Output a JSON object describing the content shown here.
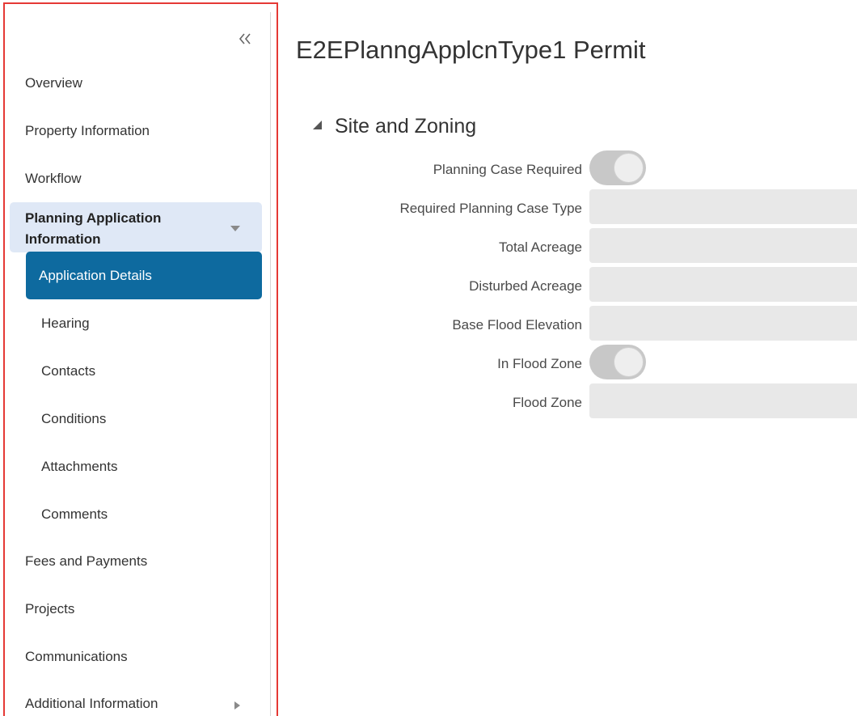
{
  "nav": {
    "overview": "Overview",
    "property_information": "Property Information",
    "workflow": "Workflow",
    "planning_application_information": "Planning Application Information",
    "application_details": "Application Details",
    "hearing": "Hearing",
    "contacts": "Contacts",
    "conditions": "Conditions",
    "attachments": "Attachments",
    "comments": "Comments",
    "fees_and_payments": "Fees and Payments",
    "projects": "Projects",
    "communications": "Communications",
    "additional_information": "Additional Information"
  },
  "icons": {
    "collapse": "double-chevron-left-icon",
    "group_expand": "caret-down-icon",
    "section_toggle": "triangle-expanded-icon",
    "submenu": "caret-right-icon"
  },
  "colors": {
    "selected_bg": "#0e6a9f",
    "group_bg": "#dfe8f6",
    "highlight_border": "#e53935",
    "field_bg": "#e8e8e8",
    "toggle_bg": "#c8c8c8"
  },
  "page": {
    "title": "E2EPlanngApplcnType1 Permit"
  },
  "section": {
    "title": "Site and Zoning",
    "fields": {
      "planning_case_required": {
        "label": "Planning Case Required",
        "value": "off"
      },
      "required_planning_case_type": {
        "label": "Required Planning Case Type",
        "value": ""
      },
      "total_acreage": {
        "label": "Total Acreage",
        "value": ""
      },
      "disturbed_acreage": {
        "label": "Disturbed Acreage",
        "value": ""
      },
      "base_flood_elevation": {
        "label": "Base Flood Elevation",
        "value": ""
      },
      "in_flood_zone": {
        "label": "In Flood Zone",
        "value": "off"
      },
      "flood_zone": {
        "label": "Flood Zone",
        "value": ""
      }
    }
  }
}
